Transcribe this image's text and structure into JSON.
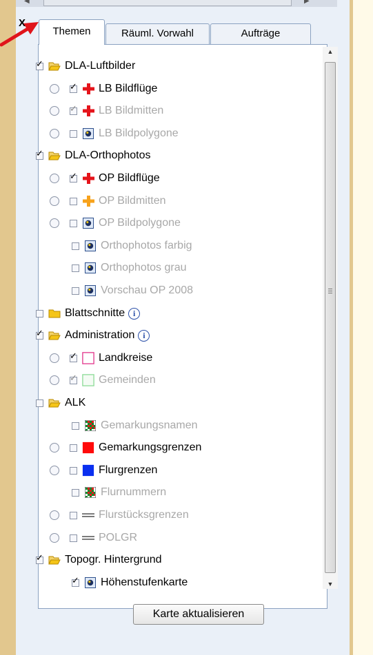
{
  "tabs": [
    {
      "label": "Themen",
      "active": true
    },
    {
      "label": "Räuml. Vorwahl",
      "active": false
    },
    {
      "label": "Aufträge",
      "active": false
    }
  ],
  "close_label": "X",
  "scrollbar_grip": "|||",
  "tree": [
    {
      "label": "DLA-Luftbilder",
      "level": 0,
      "checked": true,
      "radio": false,
      "icon": "folder-icon",
      "dim": false
    },
    {
      "label": "LB Bildflüge",
      "level": 1,
      "checked": true,
      "radio": true,
      "icon": "red-cross-icon",
      "dim": false
    },
    {
      "label": "LB Bildmitten",
      "level": 1,
      "checked": true,
      "radio": true,
      "icon": "red-cross-icon",
      "dim": true
    },
    {
      "label": "LB Bildpolygone",
      "level": 1,
      "checked": false,
      "radio": true,
      "icon": "raster-layer-icon",
      "dim": true
    },
    {
      "label": "DLA-Orthophotos",
      "level": 0,
      "checked": true,
      "radio": false,
      "icon": "folder-icon",
      "dim": false
    },
    {
      "label": "OP Bildflüge",
      "level": 1,
      "checked": true,
      "radio": true,
      "icon": "red-cross-icon",
      "dim": false
    },
    {
      "label": "OP Bildmitten",
      "level": 1,
      "checked": false,
      "radio": true,
      "icon": "orange-cross-icon",
      "dim": true
    },
    {
      "label": "OP Bildpolygone",
      "level": 1,
      "checked": false,
      "radio": true,
      "icon": "raster-layer-icon",
      "dim": true
    },
    {
      "label": "Orthophotos farbig",
      "level": 1,
      "checked": false,
      "radio": false,
      "icon": "raster-layer-icon",
      "dim": true
    },
    {
      "label": "Orthophotos grau",
      "level": 1,
      "checked": false,
      "radio": false,
      "icon": "raster-layer-icon",
      "dim": true
    },
    {
      "label": "Vorschau OP 2008",
      "level": 1,
      "checked": false,
      "radio": false,
      "icon": "raster-layer-icon",
      "dim": true
    },
    {
      "label": "Blattschnitte",
      "level": 0,
      "checked": false,
      "radio": false,
      "icon": "folder-closed-icon",
      "dim": false,
      "info": true
    },
    {
      "label": "Administration",
      "level": 0,
      "checked": true,
      "radio": false,
      "icon": "folder-icon",
      "dim": false,
      "info": true
    },
    {
      "label": "Landkreise",
      "level": 1,
      "checked": true,
      "radio": true,
      "icon": "pink-outline-icon",
      "dim": false
    },
    {
      "label": "Gemeinden",
      "level": 1,
      "checked": true,
      "radio": true,
      "icon": "green-outline-icon",
      "dim": true
    },
    {
      "label": "ALK",
      "level": 0,
      "checked": false,
      "radio": false,
      "icon": "folder-icon",
      "dim": false
    },
    {
      "label": "Gemarkungsnamen",
      "level": 1,
      "checked": false,
      "radio": false,
      "icon": "pattern-icon",
      "dim": true
    },
    {
      "label": "Gemarkungsgrenzen",
      "level": 1,
      "checked": false,
      "radio": true,
      "icon": "red-square-icon",
      "dim": false
    },
    {
      "label": "Flurgrenzen",
      "level": 1,
      "checked": false,
      "radio": true,
      "icon": "blue-square-icon",
      "dim": false
    },
    {
      "label": "Flurnummern",
      "level": 1,
      "checked": false,
      "radio": false,
      "icon": "pattern-icon",
      "dim": true
    },
    {
      "label": "Flurstücksgrenzen",
      "level": 1,
      "checked": false,
      "radio": true,
      "icon": "double-line-icon",
      "dim": true
    },
    {
      "label": "POLGR",
      "level": 1,
      "checked": false,
      "radio": true,
      "icon": "double-line-icon",
      "dim": true
    },
    {
      "label": "Topogr. Hintergrund",
      "level": 0,
      "checked": true,
      "radio": false,
      "icon": "folder-icon",
      "dim": false
    },
    {
      "label": "Höhenstufenkarte",
      "level": 1,
      "checked": true,
      "radio": false,
      "icon": "raster-layer-icon",
      "dim": false
    }
  ],
  "update_button": "Karte aktualisieren"
}
